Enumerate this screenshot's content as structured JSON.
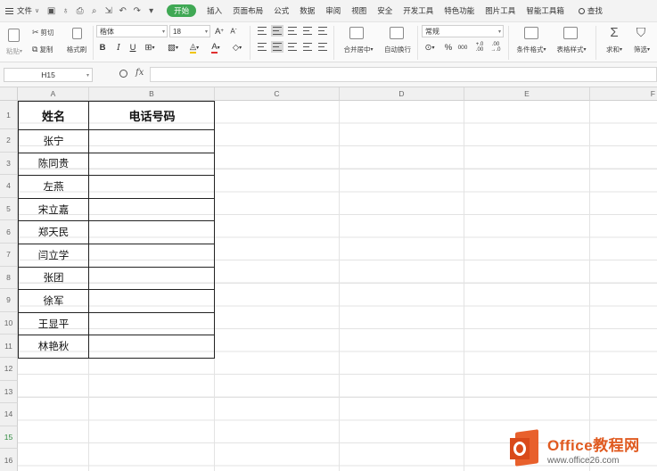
{
  "menubar": {
    "file_label": "文件",
    "tabs": [
      "开始",
      "插入",
      "页面布局",
      "公式",
      "数据",
      "审阅",
      "视图",
      "安全",
      "开发工具",
      "特色功能",
      "图片工具",
      "智能工具箱"
    ],
    "search_label": "查找",
    "active_color": "#3fa854"
  },
  "ribbon": {
    "paste": "粘贴",
    "cut": "剪切",
    "copy": "复制",
    "format_painter": "格式刷",
    "font_name": "楷体",
    "font_size": "18",
    "bold": "B",
    "italic": "I",
    "underline": "U",
    "merge_center": "合并居中",
    "wrap_text": "自动换行",
    "number_format": "常规",
    "percent": "%",
    "thousands": "000",
    "inc_decimal": "+.0\n.00",
    "dec_decimal": ".00\n→.0",
    "conditional_format": "条件格式",
    "table_style": "表格样式",
    "sum": "求和",
    "filter": "筛选"
  },
  "formula_bar": {
    "name_box": "H15",
    "fx": "fx",
    "value": ""
  },
  "sheet": {
    "columns": [
      "A",
      "B",
      "C",
      "D",
      "E",
      "F"
    ],
    "rows": [
      "1",
      "2",
      "3",
      "4",
      "5",
      "6",
      "7",
      "8",
      "9",
      "10",
      "11",
      "12",
      "13",
      "14",
      "15",
      "16"
    ],
    "active_row": "15",
    "header": {
      "name": "姓名",
      "phone": "电话号码"
    },
    "names": [
      "张宁",
      "陈同贵",
      "左燕",
      "宋立嘉",
      "郑天民",
      "闫立学",
      "张团",
      "徐军",
      "王显平",
      "林艳秋"
    ]
  },
  "watermark": {
    "title": "Office教程网",
    "url": "www.office26.com"
  }
}
